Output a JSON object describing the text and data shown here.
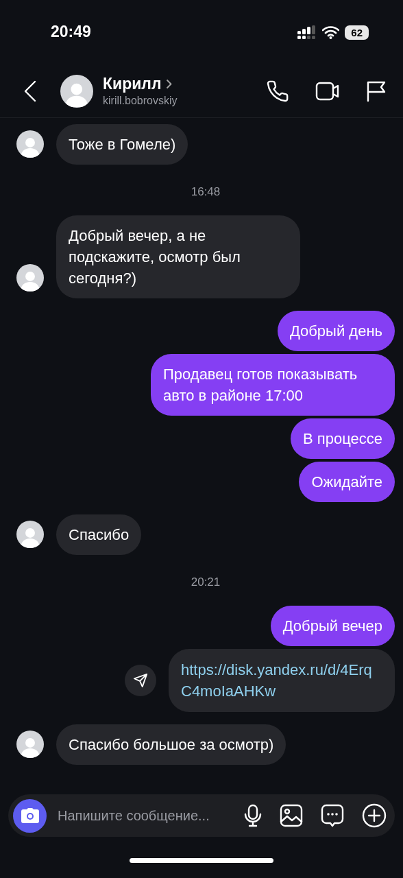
{
  "status_bar": {
    "time": "20:49",
    "battery": "62"
  },
  "header": {
    "name": "Кирилл",
    "username": "kirill.bobrovskiy"
  },
  "messages": [
    {
      "kind": "incoming",
      "text": "Тоже в Гомеле)"
    },
    {
      "kind": "time",
      "text": "16:48"
    },
    {
      "kind": "incoming",
      "text": "Добрый вечер, а не подскажите, осмотр был сегодня?)"
    },
    {
      "kind": "outgoing",
      "text": "Добрый день"
    },
    {
      "kind": "outgoing",
      "text": "Продавец готов показывать авто в районе 17:00"
    },
    {
      "kind": "outgoing",
      "text": "В процессе"
    },
    {
      "kind": "outgoing",
      "text": "Ожидайте"
    },
    {
      "kind": "incoming",
      "text": "Спасибо"
    },
    {
      "kind": "time",
      "text": "20:21"
    },
    {
      "kind": "outgoing",
      "text": "Добрый вечер"
    },
    {
      "kind": "link",
      "text": "https://disk.yandex.ru/d/4ErqC4moIaAHKw"
    },
    {
      "kind": "incoming",
      "text": "Спасибо большое за осмотр)"
    }
  ],
  "composer": {
    "placeholder": "Напишите сообщение..."
  }
}
